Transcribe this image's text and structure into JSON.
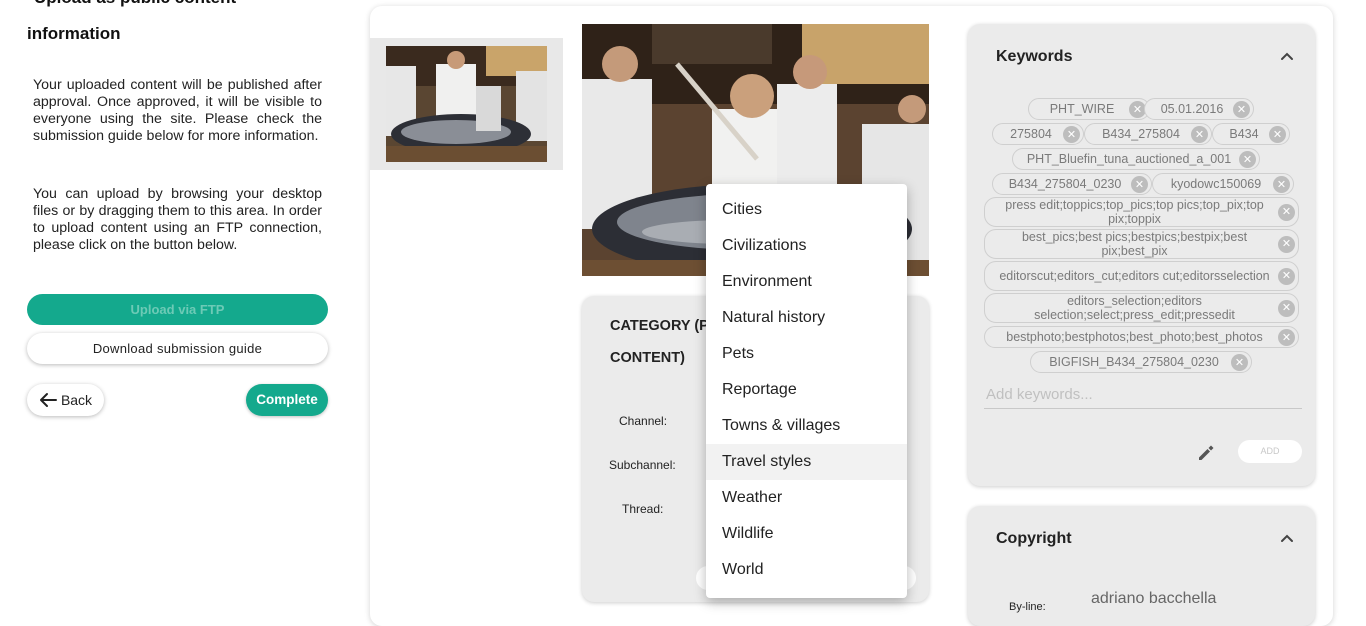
{
  "left": {
    "title_line1": "Upload as public content",
    "title_line2": "information",
    "paragraph1": "Your uploaded content will be published after approval. Once approved, it will be visible to everyone using the site. Please check the submission guide below for more information.",
    "paragraph2": "You can upload by browsing your desktop files or by dragging them to this area. In order to upload content using an FTP connection, please click on the button below.",
    "ftp_button": "Upload via FTP",
    "guide_button": "Download submission guide",
    "back_button": "Back",
    "complete_button": "Complete"
  },
  "category": {
    "title": "CATEGORY (P CONTENT)",
    "channel_label": "Channel:",
    "subchannel_label": "Subchannel:",
    "thread_label": "Thread:"
  },
  "dropdown": {
    "options": [
      "Cities",
      "Civilizations",
      "Environment",
      "Natural history",
      "Pets",
      "Reportage",
      "Towns & villages",
      "Travel styles",
      "Weather",
      "Wildlife",
      "World"
    ],
    "highlighted": "Travel styles"
  },
  "keywords": {
    "title": "Keywords",
    "chips": [
      "PHT_WIRE",
      "05.01.2016",
      "275804",
      "B434_275804",
      "B434",
      "PHT_Bluefin_tuna_auctioned_a_001",
      "B434_275804_0230",
      "kyodowc150069",
      "press edit;toppics;top_pics;top pics;top_pix;top pix;toppix",
      "best_pics;best pics;bestpics;bestpix;best pix;best_pix",
      "editorscut;editors_cut;editors cut;editorsselection",
      "editors_selection;editors selection;select;press_edit;pressedit",
      "bestphoto;bestphotos;best_photo;best_photos",
      "BIGFISH_B434_275804_0230"
    ],
    "input_placeholder": "Add keywords...",
    "add_button": "ADD"
  },
  "copyright": {
    "title": "Copyright",
    "byline_label": "By-line:",
    "byline_value": "adriano bacchella"
  },
  "colors": {
    "accent": "#14a98d",
    "card_bg": "#ebebeb"
  }
}
